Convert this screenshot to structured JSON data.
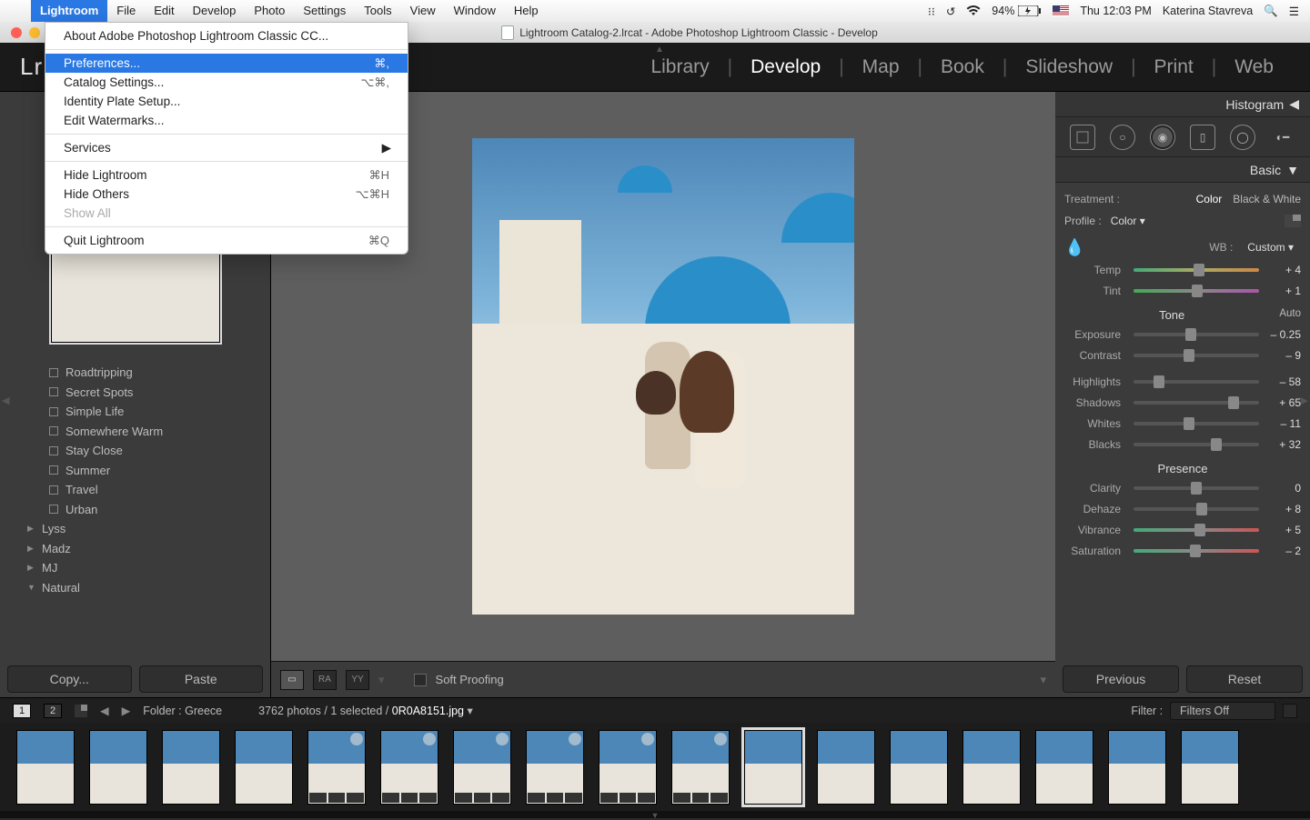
{
  "menubar": {
    "apple": "",
    "items": [
      "Lightroom",
      "File",
      "Edit",
      "Develop",
      "Photo",
      "Settings",
      "Tools",
      "View",
      "Window",
      "Help"
    ],
    "active_index": 0
  },
  "status": {
    "dropbox": "⠖",
    "timemachine": "↻",
    "wifi": "⌵",
    "battery": "94%",
    "battery_icon": "⚡",
    "clock": "Thu 12:03 PM",
    "user": "Katerina Stavreva",
    "search": "⌕",
    "menu": "≡"
  },
  "dropdown": {
    "about": "About Adobe Photoshop Lightroom Classic CC...",
    "prefs": "Preferences...",
    "prefs_sc": "⌘,",
    "catalog": "Catalog Settings...",
    "catalog_sc": "⌥⌘,",
    "identity": "Identity Plate Setup...",
    "watermarks": "Edit Watermarks...",
    "services": "Services",
    "hide": "Hide Lightroom",
    "hide_sc": "⌘H",
    "hideo": "Hide Others",
    "hideo_sc": "⌥⌘H",
    "showall": "Show All",
    "quit": "Quit Lightroom",
    "quit_sc": "⌘Q"
  },
  "window_title": "Lightroom Catalog-2.lrcat - Adobe Photoshop Lightroom Classic - Develop",
  "modules": [
    "Library",
    "Develop",
    "Map",
    "Book",
    "Slideshow",
    "Print",
    "Web"
  ],
  "module_active": 1,
  "logo": "Lr",
  "left": {
    "presets": [
      "Roadtripping",
      "Secret Spots",
      "Simple Life",
      "Somewhere Warm",
      "Stay Close",
      "Summer",
      "Travel",
      "Urban"
    ],
    "groups": [
      "Lyss",
      "Madz",
      "MJ",
      "Natural"
    ],
    "copy": "Copy...",
    "paste": "Paste"
  },
  "center": {
    "soft": "Soft Proofing",
    "tb": [
      "▭",
      "R",
      "A",
      "Y",
      "Y"
    ]
  },
  "right": {
    "histogram": "Histogram",
    "basic": "Basic",
    "treatment_l": "Treatment :",
    "color": "Color",
    "bw": "Black & White",
    "profile_l": "Profile :",
    "profile": "Color",
    "wb_l": "WB :",
    "wb": "Custom",
    "sliders": {
      "temp": {
        "label": "Temp",
        "value": "+ 4",
        "pos": 52
      },
      "tint": {
        "label": "Tint",
        "value": "+ 1",
        "pos": 51
      },
      "tone_hd": "Tone",
      "auto": "Auto",
      "exposure": {
        "label": "Exposure",
        "value": "– 0.25",
        "pos": 46
      },
      "contrast": {
        "label": "Contrast",
        "value": "– 9",
        "pos": 44
      },
      "highlights": {
        "label": "Highlights",
        "value": "– 58",
        "pos": 20
      },
      "shadows": {
        "label": "Shadows",
        "value": "+ 65",
        "pos": 80
      },
      "whites": {
        "label": "Whites",
        "value": "– 11",
        "pos": 44
      },
      "blacks": {
        "label": "Blacks",
        "value": "+ 32",
        "pos": 66
      },
      "presence_hd": "Presence",
      "clarity": {
        "label": "Clarity",
        "value": "0",
        "pos": 50
      },
      "dehaze": {
        "label": "Dehaze",
        "value": "+ 8",
        "pos": 54
      },
      "vibrance": {
        "label": "Vibrance",
        "value": "+ 5",
        "pos": 53
      },
      "saturation": {
        "label": "Saturation",
        "value": "– 2",
        "pos": 49
      }
    },
    "previous": "Previous",
    "reset": "Reset"
  },
  "fsh": {
    "pages": [
      "1",
      "2"
    ],
    "folder_l": "Folder :",
    "folder": "Greece",
    "count": "3762 photos / 1 selected /",
    "filename": "0R0A8151.jpg",
    "filter_l": "Filter :",
    "filter": "Filters Off"
  },
  "filmstrip": {
    "count": 17,
    "selected": 10,
    "badged": [
      4,
      5,
      6,
      7,
      8,
      9
    ]
  }
}
